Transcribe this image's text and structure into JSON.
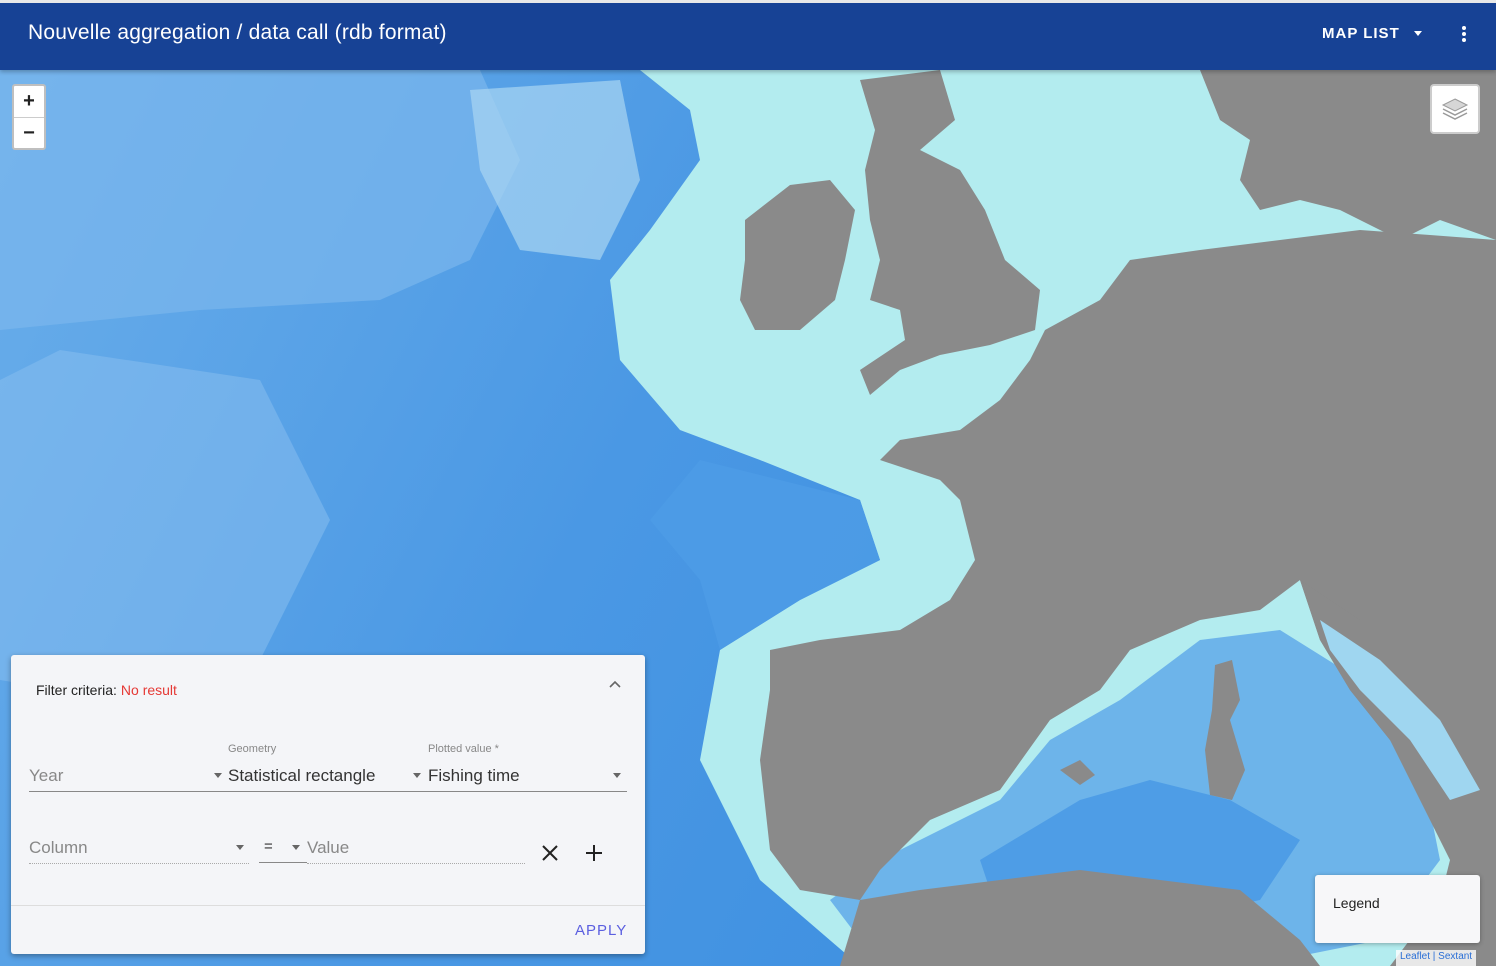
{
  "toolbar": {
    "title": "Nouvelle aggregation / data call (rdb format)",
    "map_list_label": "MAP LIST"
  },
  "map": {
    "zoom_in": "+",
    "zoom_out": "−",
    "colors": {
      "land": "#8a8a8a",
      "shallow_sea": "#b3ecef",
      "deep_sea": "#3d8fe0",
      "ocean": "#5aa3ea"
    }
  },
  "filter": {
    "header_label": "Filter criteria:",
    "status": "No result",
    "year": {
      "placeholder": "Year"
    },
    "geometry": {
      "label": "Geometry",
      "value": "Statistical rectangle"
    },
    "plotted_value": {
      "label": "Plotted value *",
      "value": "Fishing time"
    },
    "column": {
      "placeholder": "Column"
    },
    "operator": "=",
    "value": {
      "placeholder": "Value"
    },
    "apply_label": "APPLY"
  },
  "legend": {
    "title": "Legend"
  },
  "attribution": "Leaflet | Sextant"
}
